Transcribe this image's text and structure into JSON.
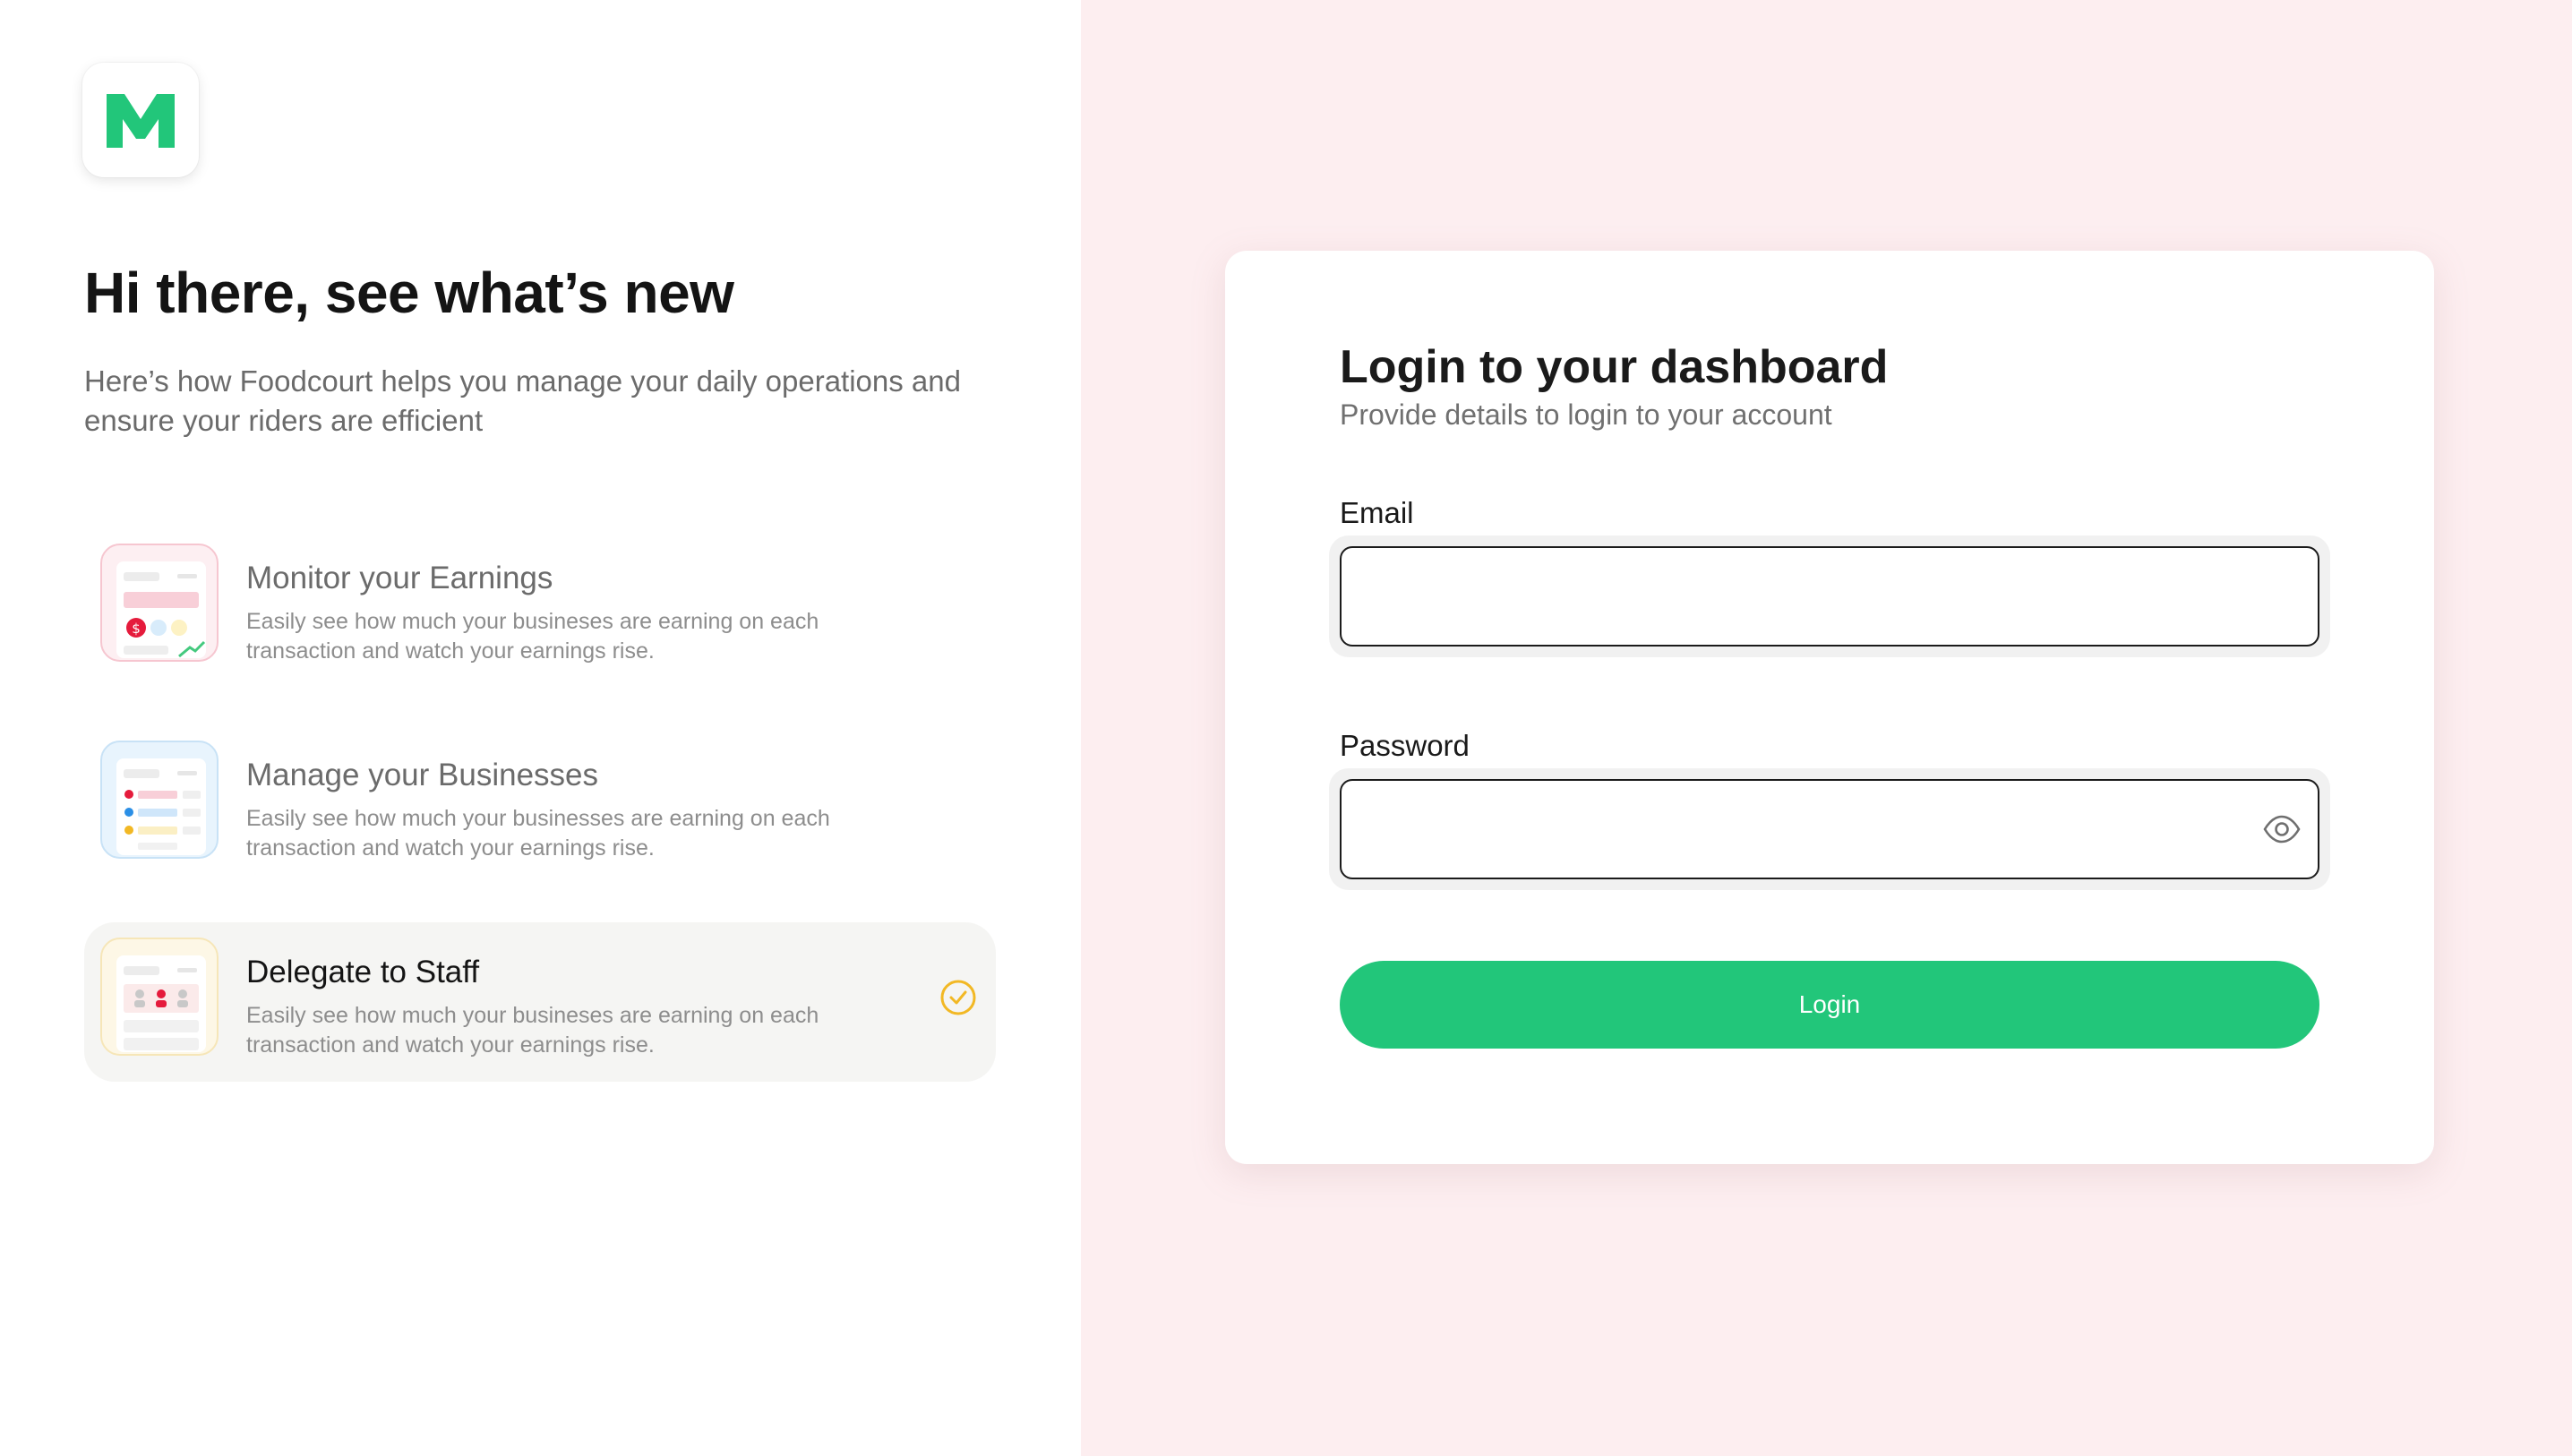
{
  "brand": {
    "logo_letter": "M",
    "logo_color": "#22c67a"
  },
  "intro": {
    "headline": "Hi there, see what’s new",
    "subhead": "Here’s how Foodcourt helps you manage your daily operations and ensure your riders are efficient"
  },
  "features": [
    {
      "title": "Monitor your Earnings",
      "description": "Easily see how much your busineses are earning on each transaction and watch your earnings rise.",
      "icon": "earnings-thumbnail",
      "accent": "#f4b6c2"
    },
    {
      "title": "Manage your Businesses",
      "description": "Easily see how much your businesses are earning on each transaction and watch your earnings rise.",
      "icon": "businesses-thumbnail",
      "accent": "#bfe0f7"
    },
    {
      "title": "Delegate to Staff",
      "description": "Easily see how much your busineses are earning on each transaction and watch your earnings rise.",
      "icon": "staff-thumbnail",
      "accent": "#f7e8b5",
      "selected": true
    }
  ],
  "login": {
    "title": "Login to your dashboard",
    "subtitle": "Provide details to login to your account",
    "email_label": "Email",
    "email_value": "",
    "password_label": "Password",
    "password_value": "",
    "button_label": "Login"
  },
  "colors": {
    "accent": "#22c67a",
    "right_background": "#fdeef0",
    "check": "#f2b824"
  }
}
